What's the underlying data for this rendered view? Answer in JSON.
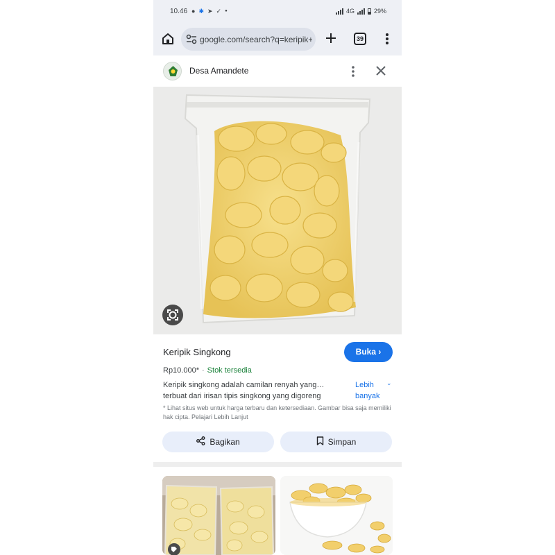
{
  "status_bar": {
    "time": "10.46",
    "network": "4G",
    "battery": "29%"
  },
  "browser": {
    "url": "google.com/search?q=keripik+",
    "tab_count": "39"
  },
  "panel": {
    "site_name": "Desa Amandete"
  },
  "product": {
    "title": "Keripik Singkong",
    "open_button": "Buka",
    "price": "Rp10.000*",
    "stock": "Stok tersedia",
    "description_line1": "Keripik singkong adalah camilan renyah yang…",
    "description_line2": "terbuat dari irisan tipis singkong yang digoreng",
    "more_link": "Lebih banyak",
    "note": "* Lihat situs web untuk harga terbaru dan ketersediaan. Gambar bisa saja memiliki hak cipta. Pelajari Lebih Lanjut",
    "share_button": "Bagikan",
    "save_button": "Simpan"
  },
  "icons": [
    "home-icon",
    "tune-icon",
    "plus-icon",
    "tabs-icon",
    "more-vert-icon",
    "close-icon",
    "lens-icon",
    "share-icon",
    "bookmark-icon",
    "chevron-right-icon",
    "chevron-down-icon",
    "tag-icon"
  ],
  "colors": {
    "accent": "#1a73e8",
    "stock_green": "#188038",
    "chrome_bg": "#eef0f5",
    "secondary_button_bg": "#e8eefa"
  }
}
